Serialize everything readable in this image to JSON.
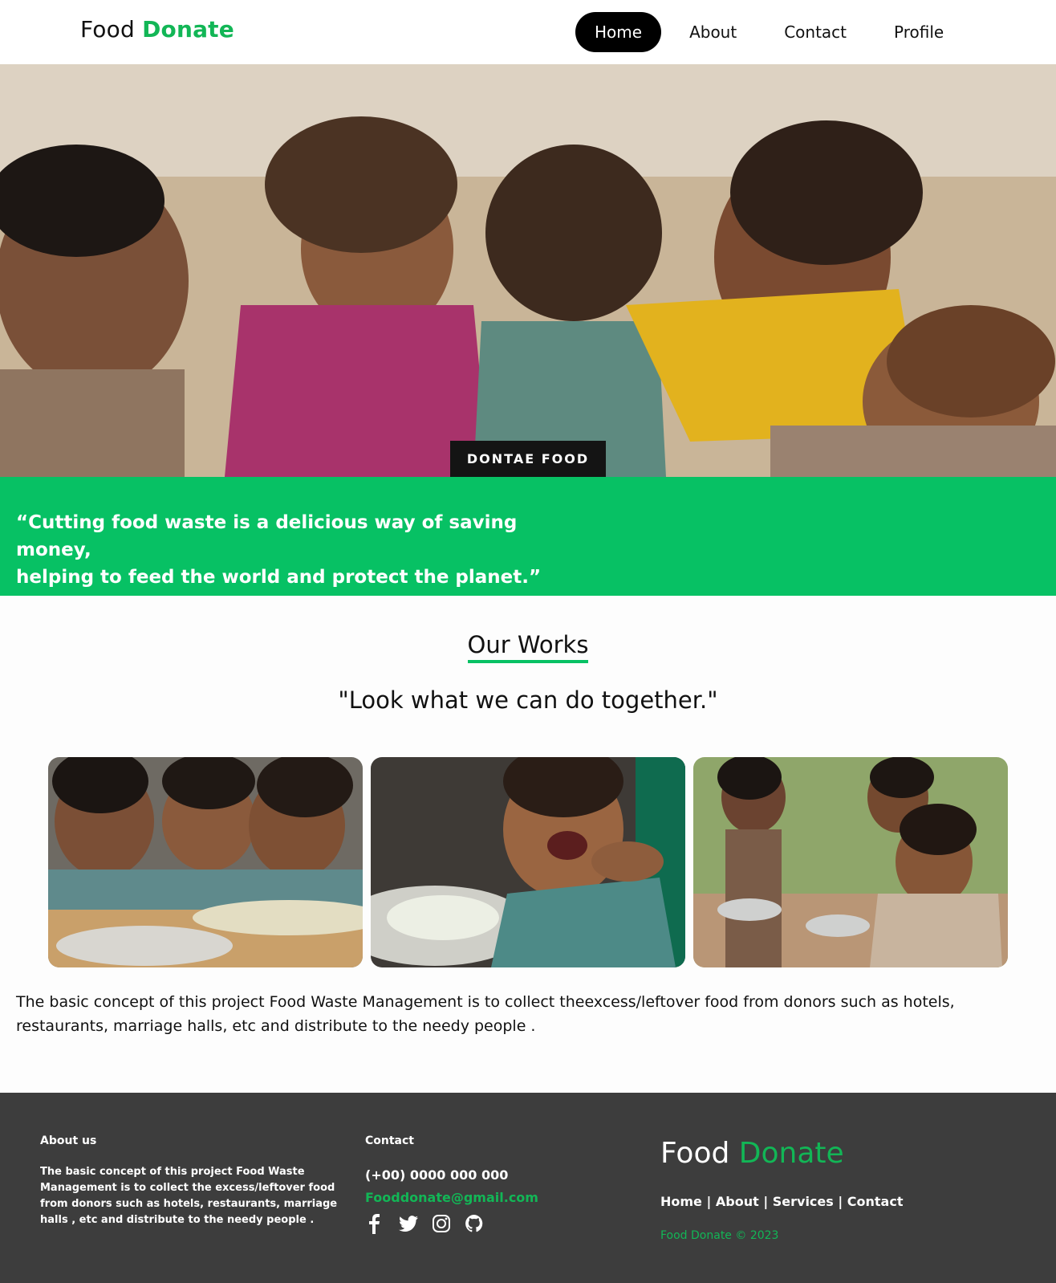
{
  "brand": {
    "name_part1": "Food",
    "name_part2": "Donate",
    "accent_color": "#12b656"
  },
  "nav": {
    "items": [
      {
        "label": "Home",
        "active": true
      },
      {
        "label": "About",
        "active": false
      },
      {
        "label": "Contact",
        "active": false
      },
      {
        "label": "Profile",
        "active": false
      }
    ]
  },
  "hero": {
    "button_label": "DONTAE FOOD"
  },
  "quote": {
    "line1": "“Cutting food waste is a delicious way of saving money,",
    "line2": "helping to feed the world and protect the planet.”"
  },
  "works": {
    "title": "Our Works",
    "subtitle": "\"Look what we can do together.\""
  },
  "concept_text": "The basic concept of this project Food Waste Management is to collect theexcess/leftover food from donors such as hotels, restaurants, marriage halls, etc and distribute to the needy people .",
  "footer": {
    "about_heading": "About us",
    "about_text": "The basic concept of this project Food Waste Management is to collect the excess/leftover food from donors such as hotels, restaurants, marriage halls , etc and distribute to the needy people .",
    "contact_heading": "Contact",
    "phone": "(+00) 0000 000 000",
    "email": "Fooddonate@gmail.com",
    "social_icons": [
      "facebook-icon",
      "twitter-icon",
      "instagram-icon",
      "github-icon"
    ],
    "brand_part1": "Food",
    "brand_part2": "Donate",
    "links": [
      "Home",
      "About",
      "Services",
      "Contact"
    ],
    "link_separator": " | ",
    "copyright": "Food Donate © 2023"
  },
  "colors": {
    "green": "#07c164",
    "footer_bg": "#3d3d3d"
  }
}
